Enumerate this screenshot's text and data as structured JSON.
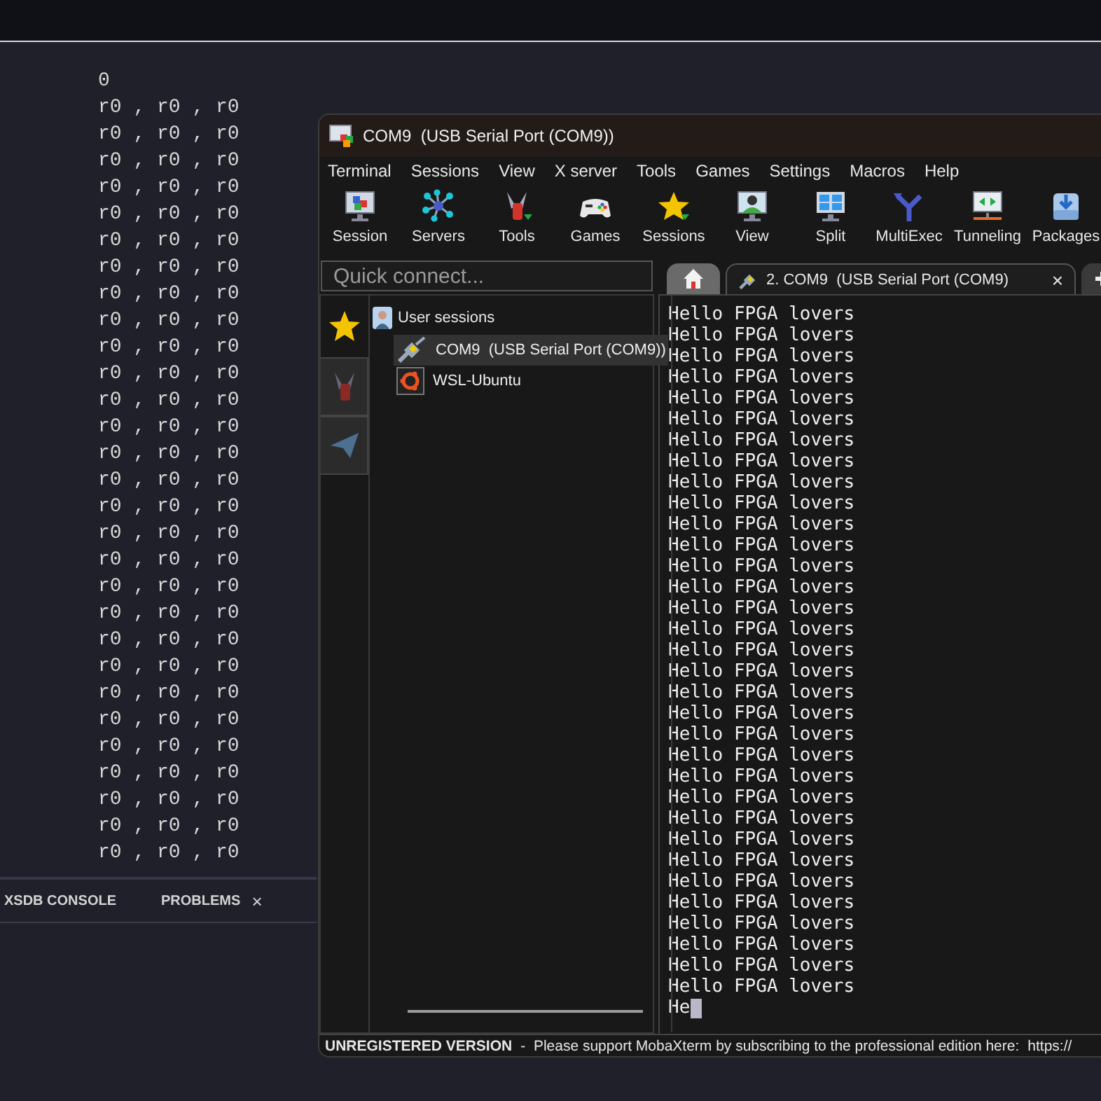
{
  "editor": {
    "lines": [
      "0",
      "r0 , r0 , r0",
      "r0 , r0 , r0",
      "r0 , r0 , r0",
      "r0 , r0 , r0",
      "r0 , r0 , r0",
      "r0 , r0 , r0",
      "r0 , r0 , r0",
      "r0 , r0 , r0",
      "r0 , r0 , r0",
      "r0 , r0 , r0",
      "r0 , r0 , r0",
      "r0 , r0 , r0",
      "r0 , r0 , r0",
      "r0 , r0 , r0",
      "r0 , r0 , r0",
      "r0 , r0 , r0",
      "r0 , r0 , r0",
      "r0 , r0 , r0",
      "r0 , r0 , r0",
      "r0 , r0 , r0",
      "r0 , r0 , r0",
      "r0 , r0 , r0",
      "r0 , r0 , r0",
      "r0 , r0 , r0",
      "r0 , r0 , r0",
      "r0 , r0 , r0",
      "r0 , r0 , r0",
      "r0 , r0 , r0",
      "r0 , r0 , r0"
    ]
  },
  "bottom_panel": {
    "tabs": [
      {
        "label": "XSDB CONSOLE"
      },
      {
        "label": "PROBLEMS",
        "close": "×"
      }
    ]
  },
  "window": {
    "title": "COM9  (USB Serial Port (COM9))",
    "menu": [
      "Terminal",
      "Sessions",
      "View",
      "X server",
      "Tools",
      "Games",
      "Settings",
      "Macros",
      "Help"
    ],
    "toolbar": [
      {
        "label": "Session"
      },
      {
        "label": "Servers"
      },
      {
        "label": "Tools"
      },
      {
        "label": "Games"
      },
      {
        "label": "Sessions"
      },
      {
        "label": "View"
      },
      {
        "label": "Split"
      },
      {
        "label": "MultiExec"
      },
      {
        "label": "Tunneling"
      },
      {
        "label": "Packages"
      }
    ],
    "quick_connect": {
      "placeholder": "Quick connect..."
    },
    "tabs": [
      {
        "kind": "home",
        "selected": false
      },
      {
        "kind": "session",
        "label": "2. COM9  (USB Serial Port (COM9)",
        "close": "×",
        "selected": true
      },
      {
        "kind": "new"
      }
    ],
    "side_tabs": [
      {
        "kind": "star",
        "selected": true
      },
      {
        "kind": "tools",
        "selected": false
      },
      {
        "kind": "send",
        "selected": false
      }
    ],
    "sessions": {
      "label": "User sessions",
      "children": [
        {
          "kind": "serial",
          "label": "COM9  (USB Serial Port (COM9))",
          "selected": true
        },
        {
          "kind": "wsl",
          "label": "WSL-Ubuntu",
          "selected": false
        }
      ]
    },
    "terminal": {
      "lines": [
        "Hello FPGA lovers",
        "Hello FPGA lovers",
        "Hello FPGA lovers",
        "Hello FPGA lovers",
        "Hello FPGA lovers",
        "Hello FPGA lovers",
        "Hello FPGA lovers",
        "Hello FPGA lovers",
        "Hello FPGA lovers",
        "Hello FPGA lovers",
        "Hello FPGA lovers",
        "Hello FPGA lovers",
        "Hello FPGA lovers",
        "Hello FPGA lovers",
        "Hello FPGA lovers",
        "Hello FPGA lovers",
        "Hello FPGA lovers",
        "Hello FPGA lovers",
        "Hello FPGA lovers",
        "Hello FPGA lovers",
        "Hello FPGA lovers",
        "Hello FPGA lovers",
        "Hello FPGA lovers",
        "Hello FPGA lovers",
        "Hello FPGA lovers",
        "Hello FPGA lovers",
        "Hello FPGA lovers",
        "Hello FPGA lovers",
        "Hello FPGA lovers",
        "Hello FPGA lovers",
        "Hello FPGA lovers",
        "Hello FPGA lovers",
        "Hello FPGA lovers"
      ],
      "input": "He"
    },
    "status_bar": {
      "notice": "UNREGISTERED VERSION",
      "message": "-  Please support MobaXterm by subscribing to the professional edition here:",
      "link": "https://"
    }
  }
}
